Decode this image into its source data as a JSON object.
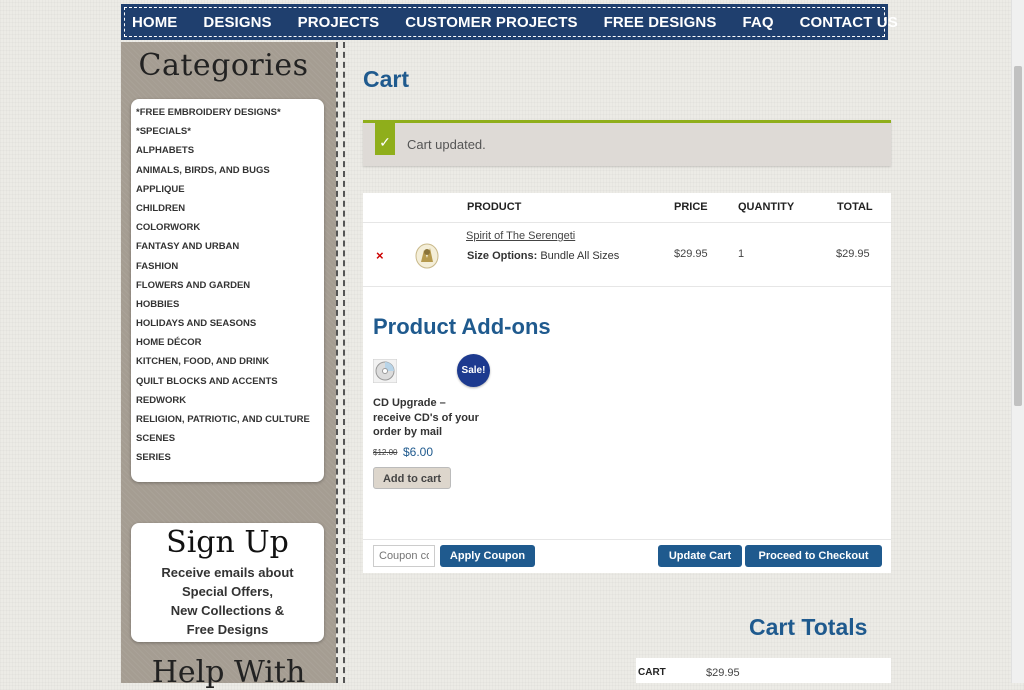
{
  "nav": {
    "items": [
      "HOME",
      "DESIGNS",
      "PROJECTS",
      "CUSTOMER PROJECTS",
      "FREE DESIGNS",
      "FAQ",
      "CONTACT US"
    ]
  },
  "sidebar": {
    "categories_heading": "Categories",
    "categories": [
      "*FREE EMBROIDERY DESIGNS*",
      "*SPECIALS*",
      "ALPHABETS",
      "ANIMALS, BIRDS, AND BUGS",
      "APPLIQUE",
      "CHILDREN",
      "COLORWORK",
      "FANTASY AND URBAN",
      "FASHION",
      "FLOWERS AND GARDEN",
      "HOBBIES",
      "HOLIDAYS AND SEASONS",
      "HOME DÉCOR",
      "KITCHEN, FOOD, AND DRINK",
      "QUILT BLOCKS AND ACCENTS",
      "REDWORK",
      "RELIGION, PATRIOTIC, AND CULTURE",
      "SCENES",
      "SERIES"
    ],
    "signup_title": "Sign Up",
    "signup_lines": [
      "Receive emails about",
      "Special Offers,",
      "New Collections &",
      "Free Designs"
    ],
    "help_heading": "Help With"
  },
  "main": {
    "title": "Cart",
    "notice": {
      "check": "✓",
      "text": "Cart updated."
    },
    "table": {
      "headers": {
        "product": "PRODUCT",
        "price": "PRICE",
        "quantity": "QUANTITY",
        "total": "TOTAL"
      },
      "row": {
        "remove": "×",
        "product_name": "Spirit of The Serengeti",
        "size_label": "Size Options:",
        "size_value": "Bundle All Sizes",
        "price": "$29.95",
        "quantity": "1",
        "total": "$29.95"
      }
    },
    "addons": {
      "title": "Product Add-ons",
      "sale_badge": "Sale!",
      "item_name": "CD Upgrade – receive CD's of your order by mail",
      "old_price": "$12.00",
      "new_price": "$6.00",
      "add_button": "Add to cart"
    },
    "coupon": {
      "placeholder": "Coupon code",
      "apply_button": "Apply Coupon"
    },
    "update_button": "Update Cart",
    "checkout_button": "Proceed to Checkout",
    "totals": {
      "title": "Cart Totals",
      "row_label": "CART",
      "row_value": "$29.95"
    }
  },
  "colors": {
    "nav_bg": "#1f3f6e",
    "heading_blue": "#1f5a8e",
    "success_green": "#8fae1b",
    "remove_red": "#cc0000",
    "sale_badge": "#1d3a8f"
  }
}
